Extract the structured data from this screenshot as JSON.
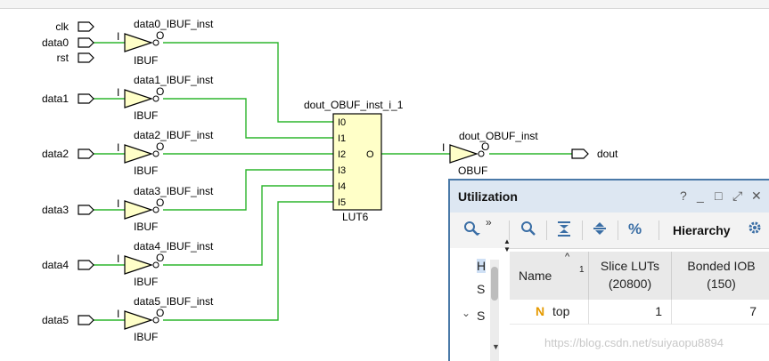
{
  "schematic": {
    "inputs": [
      "clk",
      "data0",
      "rst",
      "data1",
      "data2",
      "data3",
      "data4",
      "data5"
    ],
    "ibufs": [
      {
        "name": "data0_IBUF_inst",
        "type": "IBUF",
        "pin_in": "I",
        "pin_out": "O"
      },
      {
        "name": "data1_IBUF_inst",
        "type": "IBUF",
        "pin_in": "I",
        "pin_out": "O"
      },
      {
        "name": "data2_IBUF_inst",
        "type": "IBUF",
        "pin_in": "I",
        "pin_out": "O"
      },
      {
        "name": "data3_IBUF_inst",
        "type": "IBUF",
        "pin_in": "I",
        "pin_out": "O"
      },
      {
        "name": "data4_IBUF_inst",
        "type": "IBUF",
        "pin_in": "I",
        "pin_out": "O"
      },
      {
        "name": "data5_IBUF_inst",
        "type": "IBUF",
        "pin_in": "I",
        "pin_out": "O"
      }
    ],
    "lut": {
      "name": "dout_OBUF_inst_i_1",
      "type": "LUT6",
      "inputs": [
        "I0",
        "I1",
        "I2",
        "I3",
        "I4",
        "I5"
      ],
      "output": "O"
    },
    "obuf": {
      "name": "dout_OBUF_inst",
      "type": "OBUF",
      "pin_in": "I",
      "pin_out": "O"
    },
    "output_port": "dout",
    "colors": {
      "wire": "#2db52d",
      "buffer_fill": "#ffffc8",
      "lut_fill": "#ffffc8",
      "outline": "#000000"
    }
  },
  "utilization": {
    "title": "Utilization",
    "window_buttons": [
      "?",
      "_",
      "□",
      "⤢",
      "✕"
    ],
    "toolbar": {
      "search_icon": "search-icon",
      "more": "»",
      "search2_icon": "search-icon",
      "collapse_icon": "collapse-all-icon",
      "expand_icon": "expand-all-icon",
      "percent": "%",
      "hierarchy_label": "Hierarchy",
      "settings_icon": "gear-icon"
    },
    "tree_items": [
      "H",
      "S",
      "S"
    ],
    "columns": [
      {
        "label": "Name",
        "sort": "1"
      },
      {
        "label": "Slice LUTs",
        "sub": "(20800)"
      },
      {
        "label": "Bonded IOB",
        "sub": "(150)"
      }
    ],
    "rows": [
      {
        "badge": "N",
        "name": "top",
        "slice_luts": "1",
        "bonded_iob": "7"
      }
    ]
  },
  "watermark": "https://blog.csdn.net/suiyaopu8894"
}
